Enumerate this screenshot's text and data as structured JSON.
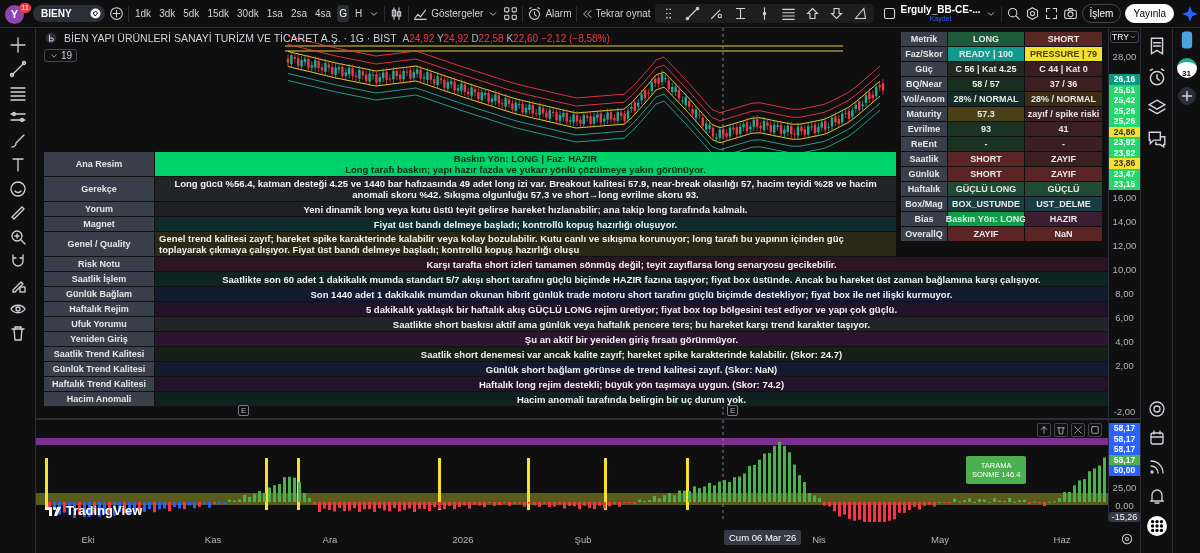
{
  "top_bar": {
    "avatar": {
      "letter": "Y",
      "badge": "11"
    },
    "symbol": "BIENY",
    "intervals": [
      {
        "label": "1dk",
        "selected": false
      },
      {
        "label": "3dk",
        "selected": false
      },
      {
        "label": "5dk",
        "selected": false
      },
      {
        "label": "15dk",
        "selected": false
      },
      {
        "label": "30dk",
        "selected": false
      },
      {
        "label": "1sa",
        "selected": false
      },
      {
        "label": "2sa",
        "selected": false
      },
      {
        "label": "4sa",
        "selected": false
      },
      {
        "label": "G",
        "selected": true
      },
      {
        "label": "H",
        "selected": false
      }
    ],
    "indicators_label": "Göstergeler",
    "alarm_label": "Alarm",
    "replay_label": "Tekrar oynat",
    "layout": {
      "name": "Erguly_BB-CE-...",
      "status": "Kaydet"
    },
    "trade_button": "İşlem",
    "publish_button": "Yayınla"
  },
  "legend": {
    "title": "BİEN YAPI ÜRÜNLERİ SANAYİ TURİZM VE TİCARET A.Ş. · 1G · BIST",
    "ohlc": [
      {
        "label": "A",
        "value": "24,92"
      },
      {
        "label": "Y",
        "value": "24,92"
      },
      {
        "label": "D",
        "value": "22,58"
      },
      {
        "label": "K",
        "value": "22,60"
      }
    ],
    "change": "−2,12 (−8,58%)",
    "indicator_count": "19"
  },
  "summary_table": {
    "rows": [
      {
        "label": "Ana Resim",
        "kind": "headline",
        "color": "#00d26a",
        "lines": [
          "Baskın Yön: LONG | Faz: HAZIR",
          "Long tarafı baskın; yapı hazır fazda ve yukarı yönlü çözülmeye yakın görünüyor."
        ]
      },
      {
        "label": "Gerekçe",
        "kind": "centered",
        "color": "#222428",
        "lines": [
          "Long gücü %56.4, katman desteği 4.25 ve 1440 bar hafızasında 49 adet long izi var. Breakout kalitesi 57.9, near-break olasılığı 57, hacim teyidi %28 ve hacim anomali skoru %42. Sıkışma olgunluğu 57.3 ve short→long evrilme skoru 93."
        ]
      },
      {
        "label": "Yorum",
        "kind": "centered",
        "color": "#1e2024",
        "lines": [
          "Yeni dinamik long veya kutu üstü teyit gelirse hareket hızlanabilir; ana takip long tarafında kalmalı."
        ]
      },
      {
        "label": "Magnet",
        "kind": "centered",
        "color": "#0e2a2c",
        "lines": [
          "Fiyat üst bandı delmeye başladı; kontrollü kopuş hazırlığı oluşuyor."
        ]
      },
      {
        "label": "Genel / Quality",
        "kind": "left",
        "color": "#2a2916",
        "lines": [
          "Genel trend kalitesi zayıf; hareket spike karakterinde kalabilir veya kolay bozulabilir. Kutu canlı ve sıkışma korunuyor; long tarafı bu yapının içinden güç toplayarak çıkmaya çalışıyor. Fiyat üst bandı delmeye başladı; kontrollü kopuş hazırlığı oluşu"
        ]
      },
      {
        "label": "Risk Notu",
        "kind": "centered",
        "color": "#2a1420",
        "lines": [
          "Karşı tarafta short izleri tamamen sönmüş değil; teyit zayıflarsa long senaryosu gecikebilir."
        ]
      },
      {
        "label": "Saatlik İşlem",
        "kind": "centered",
        "color": "#0e2420",
        "lines": [
          "Saatlikte son 60 adet 1 dakikalık mumda standart 5/7 akışı short tarafını güçlü biçimde HAZIR fazına taşıyor; fiyat box üstünde. Ancak bu hareket üst zaman bağlamına karşı çalışıyor."
        ]
      },
      {
        "label": "Günlük Bağlam",
        "kind": "centered",
        "color": "#131b30",
        "lines": [
          "Son 1440 adet 1 dakikalık mumdan okunan hibrit günlük trade motoru short tarafını güçlü biçimde destekliyor; fiyat box ile net ilişki kurmuyor."
        ]
      },
      {
        "label": "Haftalık Rejim",
        "kind": "centered",
        "color": "#23132a",
        "lines": [
          "5 dakikalık yaklaşık bir haftalık akış GÜÇLÜ LONG rejim üretiyor; fiyat box top bölgesini test ediyor ve yapı çok güçlü."
        ]
      },
      {
        "label": "Ufuk Yorumu",
        "kind": "centered",
        "color": "#222428",
        "lines": [
          "Saatlikte short baskısı aktif ama günlük veya haftalık pencere ters; bu hareket karşı trend karakter taşıyor."
        ]
      },
      {
        "label": "Yeniden Giriş",
        "kind": "centered",
        "color": "#2c1530",
        "lines": [
          "Şu an aktif bir yeniden giriş fırsatı görünmüyor."
        ]
      },
      {
        "label": "Saatlik Trend Kalitesi",
        "kind": "centered",
        "color": "#161f18",
        "lines": [
          "Saatlik short denemesi var ancak kalite zayıf; hareket spike karakterinde kalabilir. (Skor: 24.7)"
        ]
      },
      {
        "label": "Günlük Trend Kalitesi",
        "kind": "centered",
        "color": "#131b30",
        "lines": [
          "Günlük short bağlam görünse de trend kalitesi zayıf. (Skor: NaN)"
        ]
      },
      {
        "label": "Haftalık Trend Kalitesi",
        "kind": "centered",
        "color": "#23132a",
        "lines": [
          "Haftalık long rejim destekli; büyük yön taşımaya uygun. (Skor: 74.2)"
        ]
      },
      {
        "label": "Hacim Anomali",
        "kind": "centered",
        "color": "#0f2220",
        "lines": [
          "Hacim anomali tarafında belirgin bir uç durum yok."
        ]
      }
    ]
  },
  "metrics": {
    "header": {
      "label": "Metrik",
      "long": {
        "text": "LONG",
        "color": "#1e5a3a"
      },
      "short": {
        "text": "SHORT",
        "color": "#5a2626"
      }
    },
    "rows": [
      {
        "label": "Faz/Skor",
        "long": {
          "text": "READY | 100",
          "color": "#11998e"
        },
        "short": {
          "text": "PRESSURE | 79",
          "color": "#f2e230"
        }
      },
      {
        "label": "Güç",
        "long": {
          "text": "C 56 | Kat 4.25",
          "color": "#1f2b22"
        },
        "short": {
          "text": "C 44 | Kat 0",
          "color": "#3a1f22"
        }
      },
      {
        "label": "BQ/Near",
        "long": {
          "text": "58 / 57",
          "color": "#1a2e1f"
        },
        "short": {
          "text": "37 / 36",
          "color": "#3d1f22"
        }
      },
      {
        "label": "Vol/Anom",
        "long": {
          "text": "28% / NORMAL",
          "color": "#142b2a"
        },
        "short": {
          "text": "28% / NORMAL",
          "color": "#3b2d14"
        }
      },
      {
        "label": "Maturity",
        "long": {
          "text": "57.3",
          "color": "#4a4216"
        },
        "short": {
          "text": "zayıf / spike riski",
          "color": "#3b1f22"
        }
      },
      {
        "label": "Evrilme",
        "long": {
          "text": "93",
          "color": "#1a3324"
        },
        "short": {
          "text": "41",
          "color": "#3b1f22"
        }
      },
      {
        "label": "ReEnt",
        "long": {
          "text": "-",
          "color": "#1a3324"
        },
        "short": {
          "text": "-",
          "color": "#3b1f22"
        }
      },
      {
        "label": "Saatlik",
        "long": {
          "text": "SHORT",
          "color": "#5c2525"
        },
        "short": {
          "text": "ZAYIF",
          "color": "#3b1f22"
        }
      },
      {
        "label": "Günlük",
        "long": {
          "text": "SHORT",
          "color": "#5c2525"
        },
        "short": {
          "text": "ZAYIF",
          "color": "#5c2525"
        }
      },
      {
        "label": "Haftalık",
        "long": {
          "text": "GÜÇLÜ LONG",
          "color": "#1f4a35"
        },
        "short": {
          "text": "GÜÇLÜ",
          "color": "#1f4a35"
        }
      },
      {
        "label": "Box/Mag",
        "long": {
          "text": "BOX_USTUNDE",
          "color": "#1a3d3f"
        },
        "short": {
          "text": "UST_DELME",
          "color": "#1a3d45"
        }
      },
      {
        "label": "Bias",
        "long": {
          "text": "Baskın Yön: LONG",
          "color": "#0e9e48"
        },
        "short": {
          "text": "HAZIR",
          "color": "#3b1f30"
        }
      },
      {
        "label": "OverallQ",
        "long": {
          "text": "ZAYIF",
          "color": "#5c2525"
        },
        "short": {
          "text": "NaN",
          "color": "#5c2525"
        }
      }
    ]
  },
  "price_axis": {
    "currency": "TRY",
    "ticks": [
      "28,00",
      "16,00",
      "14,00",
      "12,00",
      "10,00",
      "8,00",
      "6,00",
      "4,00",
      "2,00",
      "-2,00"
    ],
    "markers": [
      {
        "text": "26,16",
        "color": "#089981"
      },
      {
        "text": "25,51",
        "color": "#22d86a"
      },
      {
        "text": "25,42",
        "color": "#22d86a"
      },
      {
        "text": "25,26",
        "color": "#22d86a"
      },
      {
        "text": "25,26",
        "color": "#22d86a"
      },
      {
        "text": "24,86",
        "color": "#f5e12b"
      },
      {
        "text": "23,92",
        "color": "#22d86a"
      },
      {
        "text": "23,92",
        "color": "#22d86a"
      },
      {
        "text": "23,86",
        "color": "#f5e12b"
      },
      {
        "text": "23,47",
        "color": "#22d86a"
      },
      {
        "text": "23,15",
        "color": "#22d86a"
      }
    ]
  },
  "event_markers": [
    "E",
    "E"
  ],
  "indicator_pane": {
    "badge": [
      "TARAMA",
      "SONME 146.4"
    ],
    "markers": [
      {
        "text": "58,17",
        "color": "#2962ff"
      },
      {
        "text": "58,17",
        "color": "#2962ff"
      },
      {
        "text": "58,17",
        "color": "#2962ff"
      },
      {
        "text": "58,17",
        "color": "#4caf50"
      },
      {
        "text": "50,00",
        "color": "#2962ff"
      }
    ],
    "ticks": [
      "25,00",
      "0,00"
    ],
    "crosshair_value": "-15,26"
  },
  "branding": "TradingView",
  "time_axis": {
    "labels": [
      "Eki",
      "Kas",
      "Ara",
      "2026",
      "Şub",
      "Nis",
      "May",
      "Haz"
    ],
    "crosshair_label": "Cum 06 Mar '26"
  },
  "side_panel": {
    "calendar_day": "31"
  }
}
